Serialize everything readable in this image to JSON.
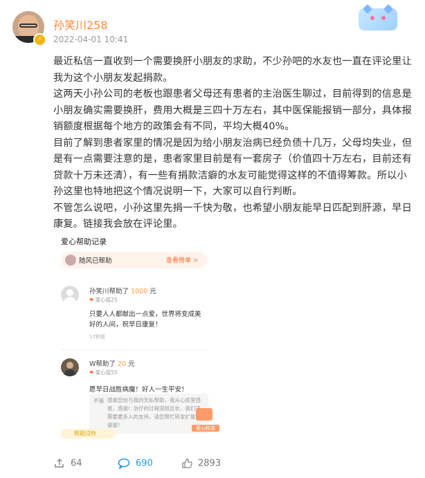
{
  "post": {
    "username": "孙笑川258",
    "timestamp": "2022-04-01 10:41",
    "paragraphs": [
      "最近私信一直收到一个需要换肝小朋友的求助，不少孙吧的水友也一直在评论里让我为这个小朋友发起捐款。",
      "这两天小孙公司的老板也跟患者父母还有患者的主治医生聊过，目前得到的信息是小朋友确实需要换肝，费用大概是三四十万左右，其中医保能报销一部分，具体报销额度根据每个地方的政策会有不同，平均大概40%。",
      "目前了解到患者家里的情况是因为给小朋友治病已经负债十几万，父母均失业，但是有一点需要注意的是，患者家里目前是有一套房子（价值四十万左右，目前还有贷款十万未还清），有一些有捐款洁癖的水友可能觉得这样的不值得筹款。所以小孙这里也特地把这个情况说明一下，大家可以自行判断。",
      "不管怎么说吧，小孙这里先捐一千快为敬，也希望小朋友能早日匹配到肝源，早日康复。链接我会放在评论里。"
    ]
  },
  "card": {
    "title": "爱心帮助记录",
    "helper_name": "随风",
    "helper_suffix": "已帮助",
    "rank_link": "查看榜单 >",
    "records": [
      {
        "name": "孙笑川",
        "helped": "帮助了",
        "amount": "1000",
        "unit": "元",
        "love": "爱心值25",
        "message": "只要人人都献出一点爱，世界将变成美好的人间，祝早日康复！",
        "ago": "17秒前"
      },
      {
        "name": "W",
        "helped": "帮助了",
        "amount": "20",
        "unit": "元",
        "love": "爱心值55",
        "message": "愿早日战胜病魔！好人一生平安！",
        "ago": ""
      }
    ],
    "thanks_label": "不猪",
    "thanks_text": "感谢您给与我的无私帮助，我从心底里感恩，感谢！治疗的过程道阻且长，我们还需要更多人的支持，请您帮忙转发扩散，谢谢！",
    "gift_label": "爱心权益",
    "bottom_tag": "帮助过你"
  },
  "footer": {
    "repost_count": "64",
    "comment_count": "690",
    "like_count": "2893"
  },
  "icons": {
    "repost": "repost-icon",
    "comment": "comment-icon",
    "like": "like-icon",
    "verified": "verified-badge-icon"
  },
  "colors": {
    "username": "#ff8c3a",
    "comment_blue": "#1d9bf0",
    "amount": "#ff9a3c"
  }
}
